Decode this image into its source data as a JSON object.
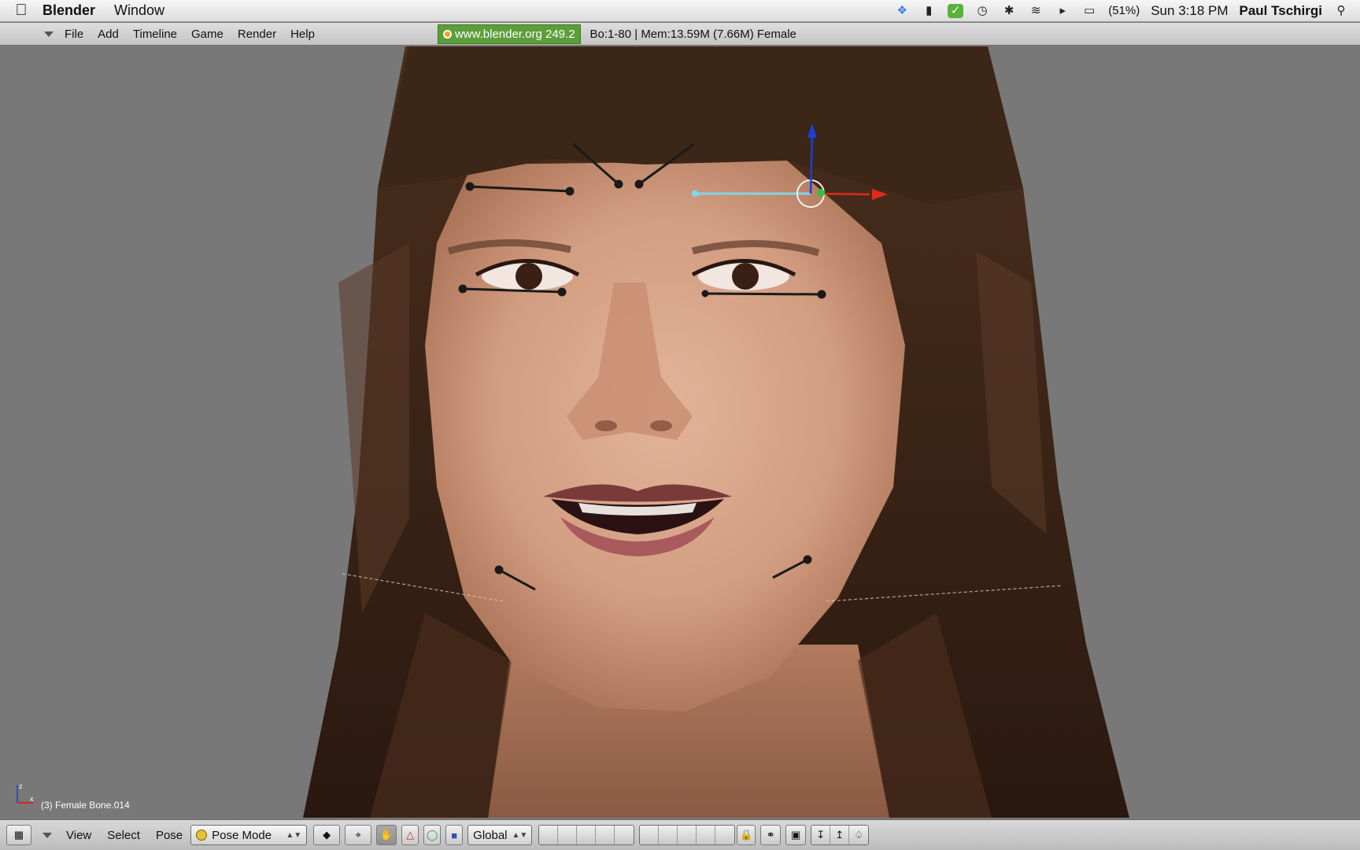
{
  "macbar": {
    "app_name": "Blender",
    "menus": [
      "Window"
    ],
    "battery": "(51%)",
    "clock": "Sun 3:18 PM",
    "user": "Paul Tschirgi"
  },
  "blender_header": {
    "menus": [
      "File",
      "Add",
      "Timeline",
      "Game",
      "Render",
      "Help"
    ],
    "url": "www.blender.org 249.2",
    "stats": "Bo:1-80  | Mem:13.59M (7.66M) Female"
  },
  "viewport": {
    "object_label": "(3) Female Bone.014",
    "axis_labels": {
      "z": "z",
      "x": "x"
    }
  },
  "toolbar": {
    "menus": [
      "View",
      "Select",
      "Pose"
    ],
    "mode": "Pose Mode",
    "orientation": "Global"
  },
  "colors": {
    "viewport_bg": "#787878",
    "hair": "#3a2416",
    "skin": "#d9a88c",
    "selected_bone": "#7fd6e6",
    "manip_x": "#e02b1b",
    "manip_y": "#36c23a",
    "manip_z": "#1a3ed8"
  }
}
